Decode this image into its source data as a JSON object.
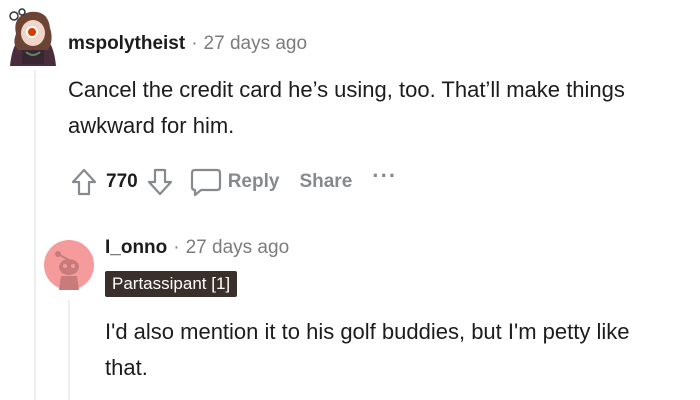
{
  "comment1": {
    "username": "mspolytheist",
    "separator": "·",
    "time": "27 days ago",
    "body": "Cancel the credit card he’s using, too. That’ll make things awkward for him.",
    "avatar_icon": "cartoon-avatar-icon"
  },
  "actions": {
    "upvote_icon": "upvote-arrow-icon",
    "vote_count": "770",
    "downvote_icon": "downvote-arrow-icon",
    "reply_icon": "speech-bubble-icon",
    "reply_label": "Reply",
    "share_label": "Share",
    "more_label": "···"
  },
  "comment2": {
    "username": "I_onno",
    "separator": "·",
    "time": "27 days ago",
    "flair": "Partassipant [1]",
    "body": "I'd also mention it to his golf buddies, but I'm petty like that.",
    "avatar_icon": "snoo-avatar-icon"
  },
  "colors": {
    "text": "#1c1c1c",
    "muted": "#7c7c7c",
    "action_gray": "#878a8c",
    "flair_bg": "#3a2f2a",
    "avatar2_bg": "#f59b9b"
  }
}
